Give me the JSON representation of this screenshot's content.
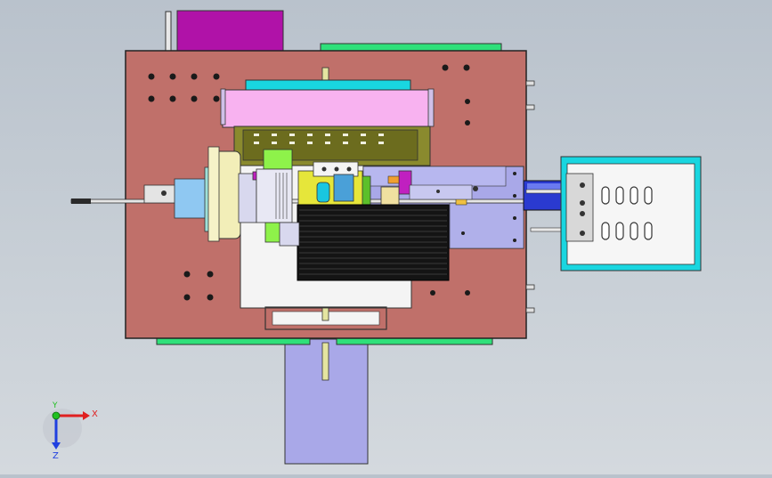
{
  "view": {
    "colors": {
      "base_plate": "#c0706a",
      "magenta_block": "#b012a8",
      "green_rail": "#2fe07a",
      "cyan_frame": "#19d6e0",
      "pink_cover": "#f8b2f0",
      "olive_block": "#8a8a2e",
      "lavender_chute": "#a9a8e8",
      "black_block": "#141414",
      "yellow_part": "#e6e63a",
      "blue_cylinder": "#2a3ad0"
    }
  },
  "triad": {
    "x_label": "X",
    "y_label": "Y",
    "z_label": "Z",
    "x_color": "#e02020",
    "y_color": "#20c020",
    "z_color": "#2040e0"
  }
}
